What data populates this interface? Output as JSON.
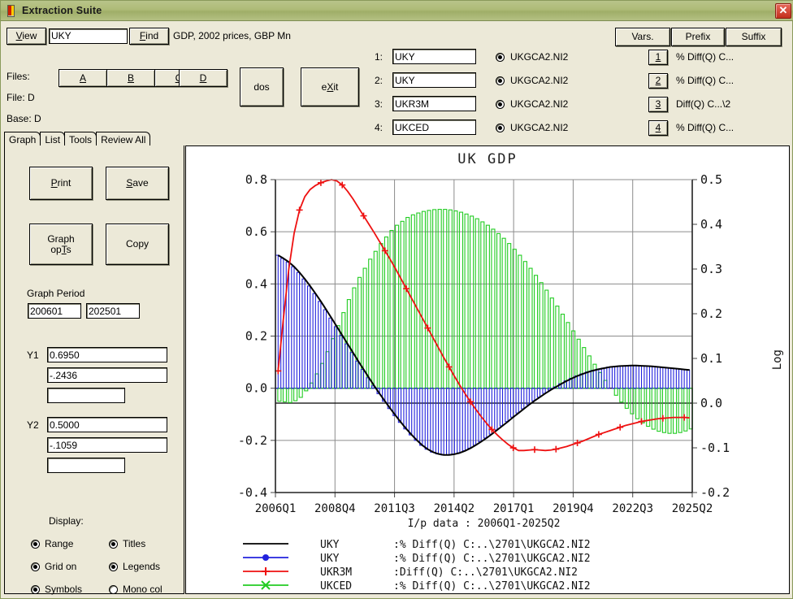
{
  "window": {
    "title": "Extraction Suite",
    "close_label": "✕",
    "accent": "#a8b772",
    "face": "#ece9d8"
  },
  "toolbar": {
    "view_label": "View",
    "view_accel": "V",
    "find_value": "UKY",
    "find_placeholder": "",
    "find_label": "Find",
    "find_accel": "F",
    "series_description": "GDP, 2002 prices, GBP Mn"
  },
  "files": {
    "label": "Files:",
    "buttons": [
      "A",
      "B",
      "C",
      "D"
    ],
    "file_line": "File: D",
    "base_line": "Base: D",
    "dos_label": "dos",
    "exit_label": "eXit",
    "exit_accel": "X"
  },
  "slots": {
    "header_buttons": [
      "Vars.",
      "Prefix",
      "Suffix"
    ],
    "rows": [
      {
        "num": "1:",
        "code": "UKY",
        "selected": true,
        "file": "UKGCA2.NI2",
        "index": "1",
        "transform": "% Diff(Q) C..."
      },
      {
        "num": "2:",
        "code": "UKY",
        "selected": true,
        "file": "UKGCA2.NI2",
        "index": "2",
        "transform": "% Diff(Q) C..."
      },
      {
        "num": "3:",
        "code": "UKR3M",
        "selected": true,
        "file": "UKGCA2.NI2",
        "index": "3",
        "transform": "Diff(Q) C...\\2"
      },
      {
        "num": "4:",
        "code": "UKCED",
        "selected": true,
        "file": "UKGCA2.NI2",
        "index": "4",
        "transform": "% Diff(Q) C..."
      }
    ]
  },
  "tabs": [
    {
      "label": "Graph",
      "selected": true
    },
    {
      "label": "List",
      "selected": false
    },
    {
      "label": "Tools",
      "selected": false
    },
    {
      "label": "Review All",
      "selected": false
    }
  ],
  "sidebar": {
    "print_label": "Print",
    "print_accel": "P",
    "save_label": "Save",
    "save_accel": "S",
    "graph_opts_line1": "Graph",
    "graph_opts_line2": "opTs",
    "graph_opts_accel": "T",
    "copy_label": "Copy",
    "graph_period_label": "Graph Period",
    "graph_period_from": "200601",
    "graph_period_to": "202501",
    "y1_label": "Y1",
    "y1_max": "0.6950",
    "y1_min": "-.2436",
    "y1_step": "",
    "y2_label": "Y2",
    "y2_max": "0.5000",
    "y2_min": "-.1059",
    "y2_step": "",
    "display_label": "Display:",
    "options": [
      {
        "label": "Range",
        "checked": true
      },
      {
        "label": "Titles",
        "checked": true
      },
      {
        "label": "Grid on",
        "checked": true
      },
      {
        "label": "Legends",
        "checked": true
      },
      {
        "label": "Symbols",
        "checked": true
      },
      {
        "label": "Mono col",
        "checked": false
      }
    ]
  },
  "chart_data": {
    "type": "line",
    "title": "UK GDP",
    "subtitle": "I/p data : 2006Q1-2025Q2",
    "xlabel": "",
    "ylabel_left": "",
    "ylabel_right": "Log",
    "grid": true,
    "legend_position": "bottom",
    "xtick_labels": [
      "2006Q1",
      "2008Q4",
      "2011Q3",
      "2014Q2",
      "2017Q1",
      "2019Q4",
      "2022Q3",
      "2025Q2"
    ],
    "ytick_left": [
      "0.8",
      "0.6",
      "0.4",
      "0.2",
      "0.0",
      "-0.2",
      "-0.4"
    ],
    "ytick_right": [
      "0.5",
      "0.4",
      "0.3",
      "0.2",
      "0.1",
      "0.0",
      "-0.1",
      "-0.2"
    ],
    "ylim_left": [
      -0.4,
      0.8
    ],
    "ylim_right": [
      -0.2,
      0.5
    ],
    "x_start": "2006Q1",
    "x_end": "2025Q2",
    "n_points": 78,
    "series": [
      {
        "name": "UKY",
        "axis": "left",
        "style": "line",
        "color": "#000000",
        "legend_code": "UKY",
        "legend_detail": ":% Diff(Q) C:..\\2701\\UKGCA2.NI2",
        "values": [
          0.51,
          0.498,
          0.484,
          0.466,
          0.444,
          0.419,
          0.392,
          0.363,
          0.333,
          0.301,
          0.269,
          0.236,
          0.203,
          0.17,
          0.137,
          0.104,
          0.072,
          0.04,
          0.009,
          -0.021,
          -0.05,
          -0.078,
          -0.105,
          -0.131,
          -0.156,
          -0.179,
          -0.2,
          -0.219,
          -0.234,
          -0.245,
          -0.252,
          -0.256,
          -0.256,
          -0.253,
          -0.248,
          -0.24,
          -0.23,
          -0.218,
          -0.205,
          -0.191,
          -0.176,
          -0.16,
          -0.144,
          -0.128,
          -0.111,
          -0.095,
          -0.079,
          -0.063,
          -0.048,
          -0.034,
          -0.02,
          -0.007,
          0.005,
          0.017,
          0.028,
          0.038,
          0.047,
          0.055,
          0.062,
          0.068,
          0.073,
          0.077,
          0.081,
          0.083,
          0.085,
          0.086,
          0.087,
          0.087,
          0.086,
          0.085,
          0.084,
          0.082,
          0.08,
          0.078,
          0.076,
          0.074,
          0.072,
          0.07
        ]
      },
      {
        "name": "UKY",
        "axis": "left",
        "style": "bar",
        "color": "#2222dd",
        "marker": "filled-circle",
        "legend_code": "UKY",
        "legend_detail": ":% Diff(Q) C:..\\2701\\UKGCA2.NI2",
        "values": [
          0.51,
          0.498,
          0.484,
          0.466,
          0.444,
          0.419,
          0.392,
          0.363,
          0.333,
          0.301,
          0.269,
          0.236,
          0.203,
          0.17,
          0.137,
          0.104,
          0.072,
          0.04,
          0.009,
          -0.021,
          -0.05,
          -0.078,
          -0.105,
          -0.131,
          -0.156,
          -0.179,
          -0.2,
          -0.219,
          -0.234,
          -0.245,
          -0.252,
          -0.256,
          -0.256,
          -0.253,
          -0.248,
          -0.24,
          -0.23,
          -0.218,
          -0.205,
          -0.191,
          -0.176,
          -0.16,
          -0.144,
          -0.128,
          -0.111,
          -0.095,
          -0.079,
          -0.063,
          -0.048,
          -0.034,
          -0.02,
          -0.007,
          0.005,
          0.017,
          0.028,
          0.038,
          0.047,
          0.055,
          0.062,
          0.068,
          0.073,
          0.077,
          0.081,
          0.083,
          0.085,
          0.086,
          0.087,
          0.087,
          0.086,
          0.085,
          0.084,
          0.082,
          0.08,
          0.078,
          0.076,
          0.074,
          0.072,
          0.07
        ]
      },
      {
        "name": "UKR3M",
        "axis": "right",
        "style": "line",
        "color": "#ee1111",
        "marker": "plus",
        "legend_code": "UKR3M",
        "legend_detail": ":Diff(Q) C:..\\2701\\UKGCA2.NI2",
        "values": [
          0.072,
          0.19,
          0.3,
          0.38,
          0.432,
          0.462,
          0.478,
          0.487,
          0.493,
          0.497,
          0.5,
          0.497,
          0.488,
          0.474,
          0.457,
          0.438,
          0.419,
          0.4,
          0.381,
          0.361,
          0.341,
          0.321,
          0.3,
          0.278,
          0.256,
          0.234,
          0.212,
          0.19,
          0.168,
          0.146,
          0.124,
          0.102,
          0.081,
          0.06,
          0.04,
          0.021,
          0.003,
          -0.014,
          -0.03,
          -0.045,
          -0.059,
          -0.071,
          -0.082,
          -0.092,
          -0.1,
          -0.106,
          -0.106,
          -0.105,
          -0.104,
          -0.105,
          -0.106,
          -0.105,
          -0.103,
          -0.1,
          -0.097,
          -0.093,
          -0.089,
          -0.085,
          -0.08,
          -0.075,
          -0.07,
          -0.066,
          -0.062,
          -0.058,
          -0.054,
          -0.05,
          -0.047,
          -0.044,
          -0.041,
          -0.039,
          -0.037,
          -0.035,
          -0.034,
          -0.033,
          -0.032,
          -0.032,
          -0.032,
          -0.033
        ]
      },
      {
        "name": "UKCED",
        "axis": "left",
        "style": "bar",
        "color": "#22cc22",
        "marker": "cross",
        "legend_code": "UKCED",
        "legend_detail": ":% Diff(Q) C:..\\2701\\UKGCA2.NI2",
        "values": [
          -0.05,
          -0.052,
          -0.055,
          -0.048,
          -0.035,
          -0.01,
          0.02,
          0.055,
          0.095,
          0.14,
          0.19,
          0.24,
          0.29,
          0.34,
          0.385,
          0.425,
          0.46,
          0.495,
          0.525,
          0.555,
          0.58,
          0.605,
          0.625,
          0.64,
          0.655,
          0.665,
          0.672,
          0.678,
          0.682,
          0.685,
          0.686,
          0.686,
          0.684,
          0.68,
          0.675,
          0.668,
          0.66,
          0.65,
          0.638,
          0.625,
          0.61,
          0.593,
          0.575,
          0.555,
          0.533,
          0.51,
          0.486,
          0.46,
          0.433,
          0.405,
          0.376,
          0.346,
          0.315,
          0.284,
          0.252,
          0.22,
          0.188,
          0.156,
          0.124,
          0.092,
          0.06,
          0.03,
          0.001,
          -0.027,
          -0.053,
          -0.077,
          -0.098,
          -0.117,
          -0.133,
          -0.146,
          -0.157,
          -0.165,
          -0.17,
          -0.173,
          -0.173,
          -0.17,
          -0.164,
          -0.156
        ]
      }
    ]
  }
}
